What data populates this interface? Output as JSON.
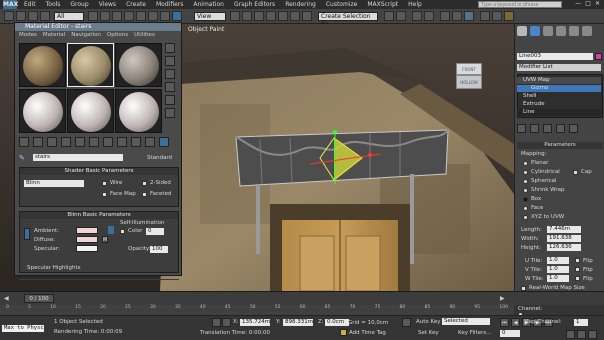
{
  "app": {
    "logo_text": "MAX",
    "menu": [
      "Edit",
      "Tools",
      "Group",
      "Views",
      "Create",
      "Modifiers",
      "Animation",
      "Graph Editors",
      "Rendering",
      "Customize",
      "MAXScript",
      "Help"
    ],
    "search_placeholder": "Type a keyword or phrase",
    "window_buttons": [
      "—",
      "□",
      "✕"
    ]
  },
  "toolbar": {
    "selection_filter": "All",
    "reference_coord": "View",
    "named_selection": "Create Selection Se"
  },
  "viewport": {
    "label": "Object Paint",
    "viewcube_top": "FRONT",
    "viewcube_side": "HOLLOW"
  },
  "material_editor": {
    "title": "Material Editor - stairs",
    "menu": [
      "Modes",
      "Material",
      "Navigation",
      "Options",
      "Utilities"
    ],
    "material_name": "stairs",
    "material_type": "Standard",
    "shader_rollout": {
      "title": "Shader Basic Parameters",
      "shader": "Blinn",
      "options": [
        "Wire",
        "2-Sided",
        "Face Map",
        "Faceted"
      ]
    },
    "blinn_rollout": {
      "title": "Blinn Basic Parameters",
      "self_illum_title": "Self-Illumination",
      "labels": [
        "Ambient:",
        "Diffuse:",
        "Specular:"
      ],
      "color_label": "Color",
      "color_value": "0",
      "opacity_label": "Opacity:",
      "opacity_value": "100",
      "map_letters": [
        "M"
      ],
      "spec_title": "Specular Highlights"
    }
  },
  "command_panel": {
    "object_name": "Line003",
    "modifier_list": "Modifier List",
    "stack": [
      "UVW Map",
      "Gizmo",
      "Shell",
      "Extrude",
      "Line"
    ],
    "parameters_title": "Parameters",
    "mapping_title": "Mapping:",
    "mapping_options": [
      "Planar",
      "Cylindrical",
      "Spherical",
      "Shrink Wrap",
      "Box",
      "Face",
      "XYZ to UVW"
    ],
    "cap_label": "Cap",
    "length_label": "Length:",
    "length_value": "7.446m",
    "width_label": "Width:",
    "width_value": "191.638",
    "height_label": "Height:",
    "height_value": "126.636",
    "u_tile_label": "U Tile:",
    "u_tile_value": "1.0",
    "v_tile_label": "V Tile:",
    "v_tile_value": "1.0",
    "w_tile_label": "W Tile:",
    "w_tile_value": "1.0",
    "flip_label": "Flip",
    "real_world_label": "Real-World Map Size",
    "channel_title": "Channel:",
    "map_channel_label": "Map Channel:",
    "map_channel_value": "1"
  },
  "timeline": {
    "frame": "0 / 100",
    "ticks": [
      "0",
      "5",
      "10",
      "15",
      "20",
      "25",
      "30",
      "35",
      "40",
      "45",
      "50",
      "55",
      "60",
      "65",
      "70",
      "75",
      "80",
      "85",
      "90",
      "95",
      "100"
    ]
  },
  "status": {
    "script_field": "Max to Physc",
    "selection": "1 Object Selected",
    "render_time": "Rendering Time: 0:00:09",
    "x_label": "X:",
    "x_value": "135.724m",
    "y_label": "Y:",
    "y_value": "898.331m",
    "z_label": "Z:",
    "z_value": "0.0cm",
    "grid": "Grid = 10,0cm",
    "translation_time": "Translation Time: 0:00:00",
    "add_time_tag": "Add Time Tag",
    "auto_key": "Auto Key",
    "auto_key_mode": "Selected",
    "set_key": "Set Key",
    "key_filters": "Key Filters...",
    "frame_value": "0"
  }
}
